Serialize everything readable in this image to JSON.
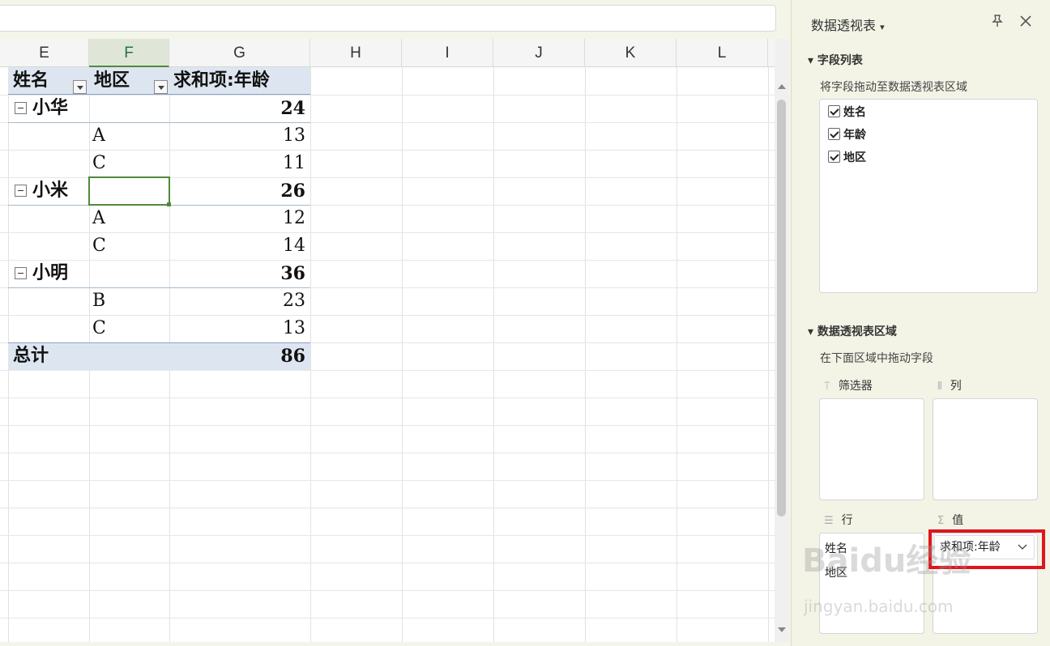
{
  "columns": [
    "E",
    "F",
    "G",
    "H",
    "I",
    "J",
    "K",
    "L"
  ],
  "pivot": {
    "headers": [
      "姓名",
      "地区",
      "求和项:年龄"
    ],
    "rows": [
      {
        "name": "小华",
        "total": "24",
        "children": [
          {
            "region": "A",
            "value": "13"
          },
          {
            "region": "C",
            "value": "11"
          }
        ]
      },
      {
        "name": "小米",
        "total": "26",
        "children": [
          {
            "region": "A",
            "value": "12"
          },
          {
            "region": "C",
            "value": "14"
          }
        ]
      },
      {
        "name": "小明",
        "total": "36",
        "children": [
          {
            "region": "B",
            "value": "23"
          },
          {
            "region": "C",
            "value": "13"
          }
        ]
      }
    ],
    "grand_total_label": "总计",
    "grand_total": "86"
  },
  "pane": {
    "title": "数据透视表",
    "title_caret": "▾",
    "pin_icon": "pin-icon",
    "close_icon": "close-icon",
    "field_list_title": "字段列表",
    "field_list_hint": "将字段拖动至数据透视表区域",
    "fields": [
      "姓名",
      "年龄",
      "地区"
    ],
    "areas_title": "数据透视表区域",
    "areas_hint": "在下面区域中拖动字段",
    "filter_label": "筛选器",
    "column_label": "列",
    "row_label": "行",
    "value_label": "值",
    "row_items": [
      "姓名",
      "地区"
    ],
    "value_items": [
      "求和项:年龄"
    ]
  },
  "watermark": {
    "logo": "Baidu经验",
    "url": "jingyan.baidu.com"
  },
  "colors": {
    "accent": "#4f8a3a",
    "highlight": "#e0141e",
    "pivot_header": "#dde6f0"
  }
}
